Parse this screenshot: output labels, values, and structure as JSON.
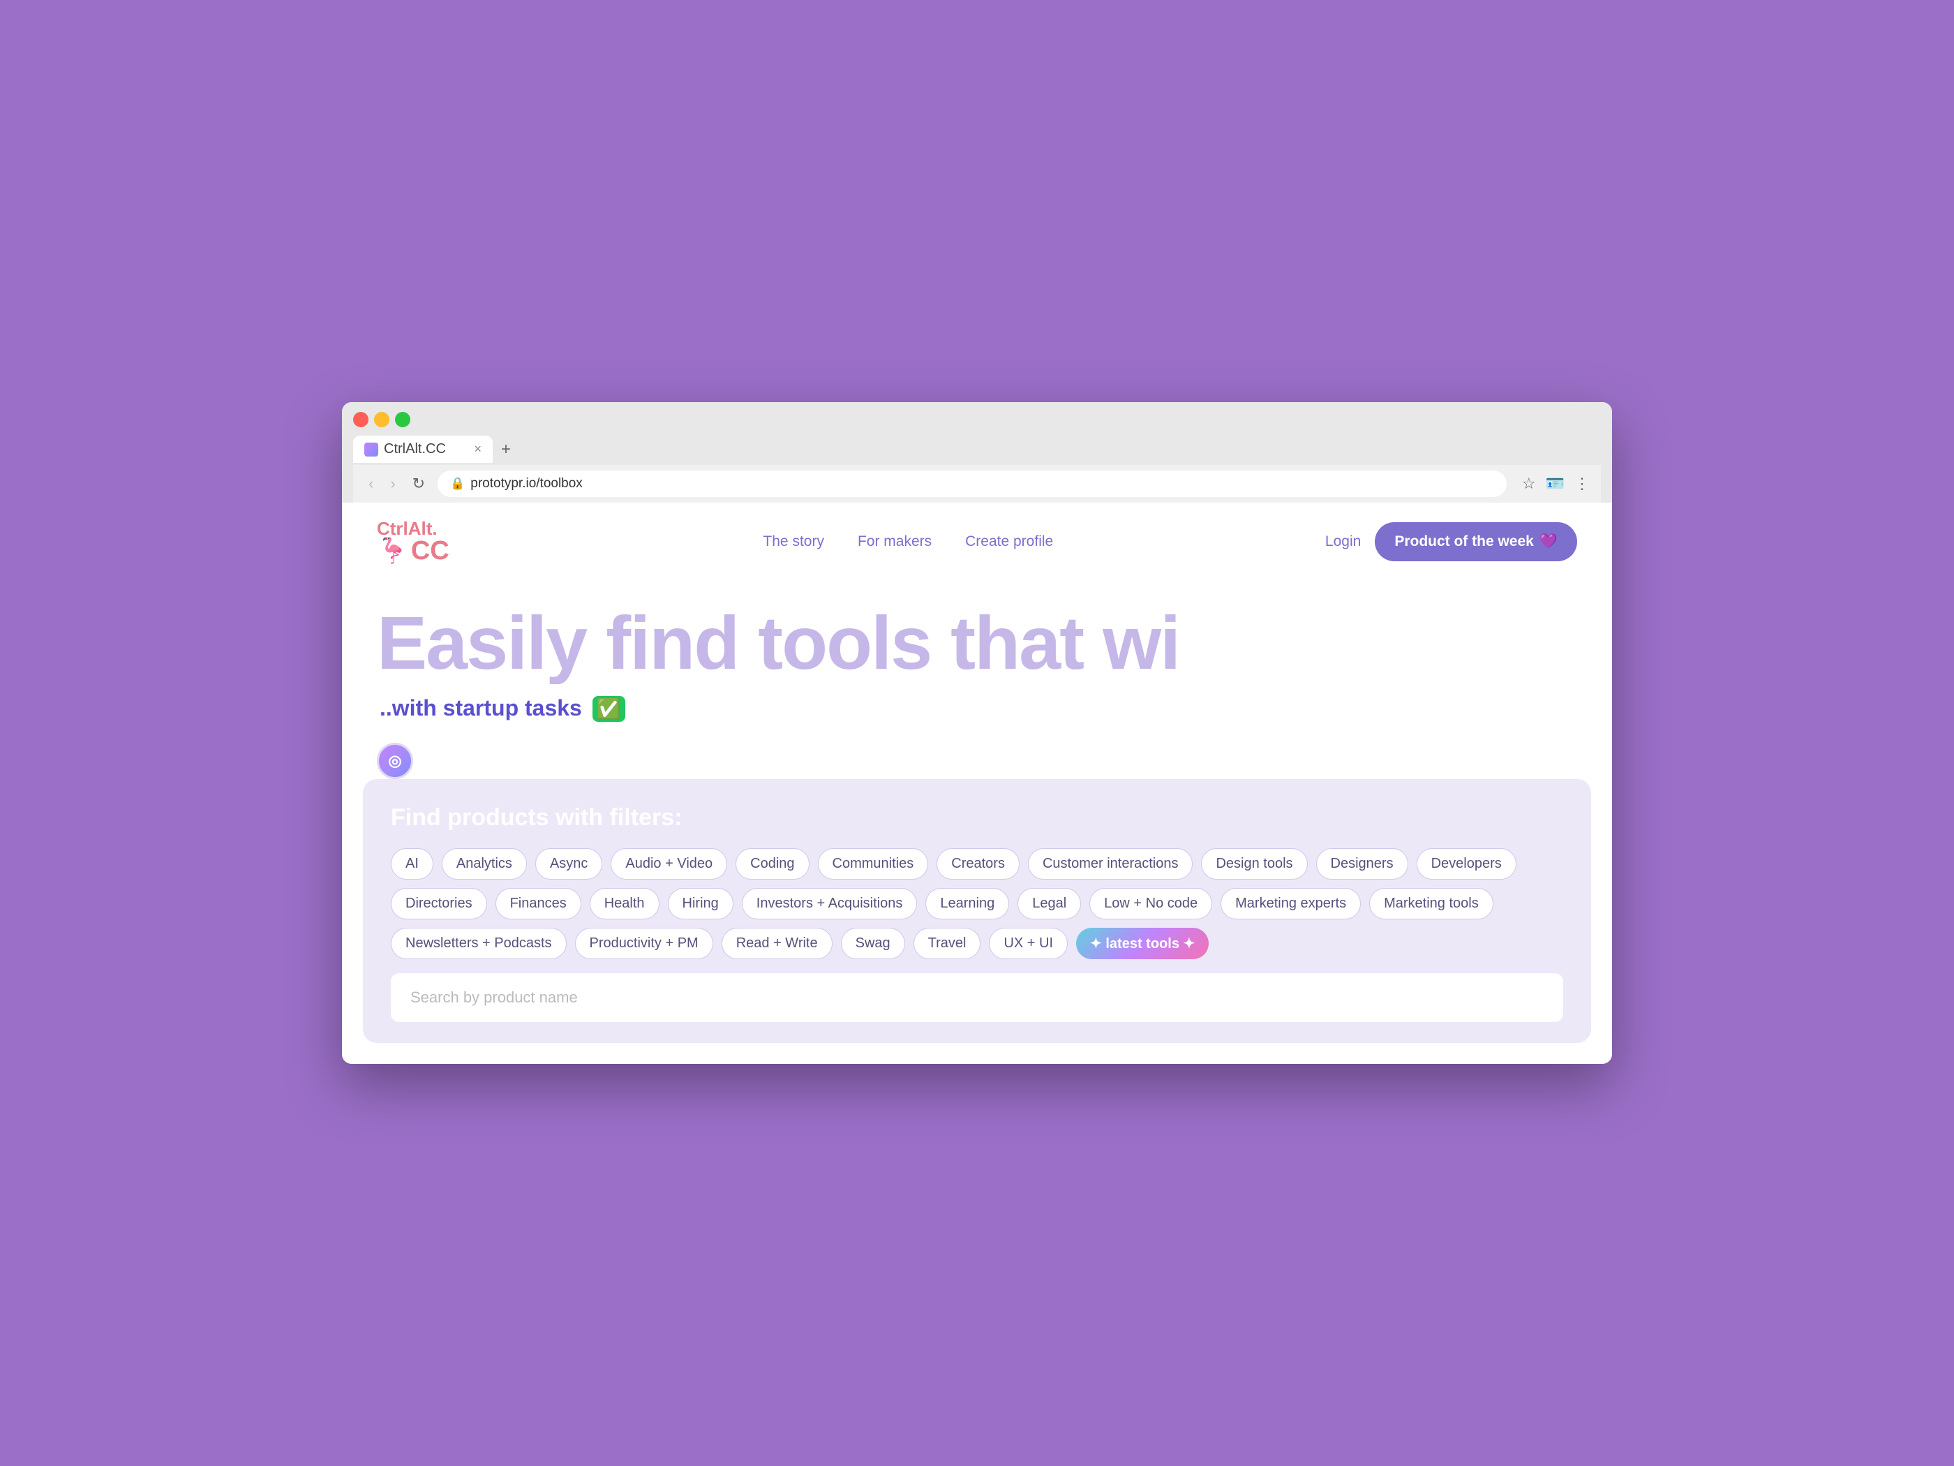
{
  "browser": {
    "tab_title": "CtrlAlt.CC",
    "tab_close": "×",
    "tab_new": "+",
    "url": "prototypr.io/toolbox",
    "nav_back": "‹",
    "nav_forward": "›",
    "nav_refresh": "↻",
    "icon_star": "☆",
    "icon_menu": "⋮"
  },
  "site": {
    "logo_top": "CtrlAlt.",
    "logo_cc": "CC",
    "flamingo": "🦩"
  },
  "nav": {
    "links": [
      {
        "label": "The story",
        "id": "the-story"
      },
      {
        "label": "For makers",
        "id": "for-makers"
      },
      {
        "label": "Create profile",
        "id": "create-profile"
      }
    ],
    "login": "Login",
    "product_week_btn": "Product of the week",
    "product_week_emoji": "💜"
  },
  "hero": {
    "headline": "Easily find tools that wi",
    "subtext": "..with startup tasks",
    "check_emoji": "✅"
  },
  "filters": {
    "title": "Find products with filters:",
    "tags": [
      "AI",
      "Analytics",
      "Async",
      "Audio + Video",
      "Coding",
      "Communities",
      "Creators",
      "Customer interactions",
      "Design tools",
      "Designers",
      "Developers",
      "Directories",
      "Finances",
      "Health",
      "Hiring",
      "Investors + Acquisitions",
      "Learning",
      "Legal",
      "Low + No code",
      "Marketing experts",
      "Marketing tools",
      "Newsletters + Podcasts",
      "Productivity + PM",
      "Read + Write",
      "Swag",
      "Travel",
      "UX + UI"
    ],
    "latest_tag": "✦ latest tools ✦",
    "search_placeholder": "Search by product name"
  }
}
